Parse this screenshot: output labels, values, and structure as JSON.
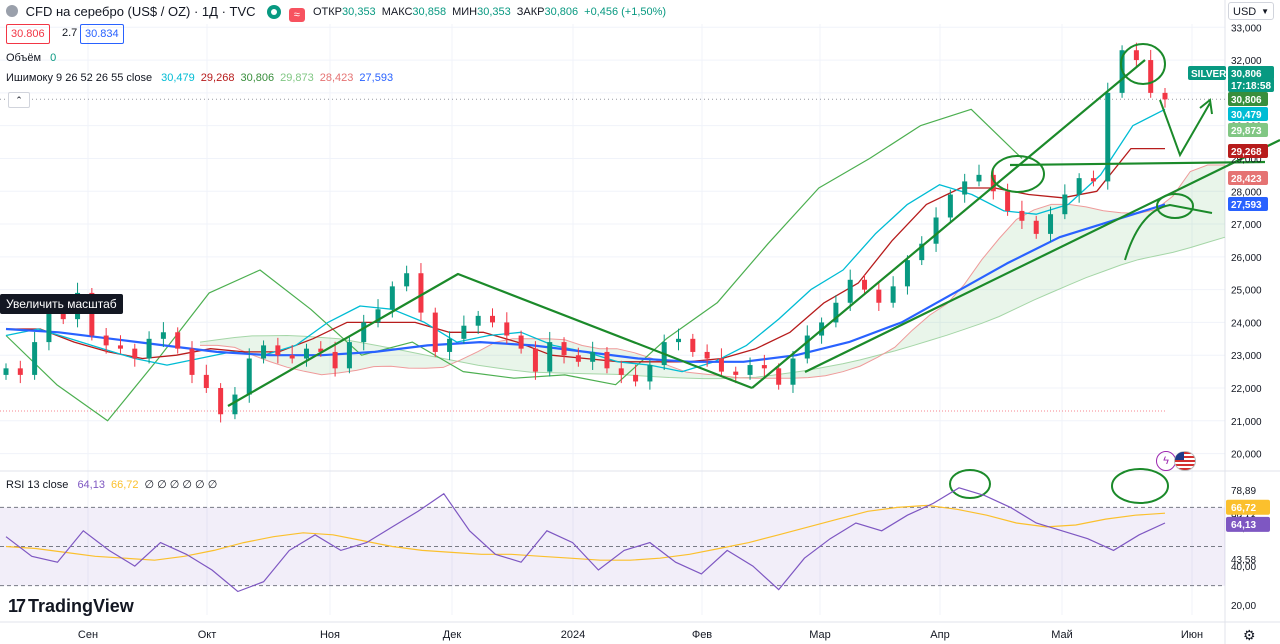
{
  "header": {
    "symbol": "CFD на серебро (US$ / OZ) · 1Д · TVC",
    "wave_icon": "≈",
    "ohlc": [
      {
        "k": "ОТКР",
        "v": "30,353"
      },
      {
        "k": "МАКС",
        "v": "30,858"
      },
      {
        "k": "МИН",
        "v": "30,353"
      },
      {
        "k": "ЗАКР",
        "v": "30,806"
      },
      {
        "k": "",
        "v": "+0,456 (+1,50%)"
      }
    ],
    "bid": "30.806",
    "spread": "2.7",
    "ask": "30.834",
    "volume_label": "Объём",
    "volume_value": "0",
    "ichimoku_label": "Ишимоку 9 26 52 26 55 close",
    "ichimoku_values": [
      {
        "v": "30,479",
        "c": "#00bcd4"
      },
      {
        "v": "29,268",
        "c": "#b71c1c"
      },
      {
        "v": "30,806",
        "c": "#388e3c"
      },
      {
        "v": "29,873",
        "c": "#81c784"
      },
      {
        "v": "28,423",
        "c": "#e57373"
      },
      {
        "v": "27,593",
        "c": "#2962ff"
      }
    ],
    "collapse": "⌃",
    "currency": "USD",
    "zoom_tooltip": "Увеличить масштаб",
    "rsi_label": "RSI 13 close",
    "rsi_values": [
      {
        "v": "64,13",
        "c": "#7e57c2"
      },
      {
        "v": "66,72",
        "c": "#fbc02d"
      },
      {
        "v": "∅ ∅ ∅ ∅ ∅ ∅",
        "c": "#131722"
      }
    ],
    "logo": "TradingView",
    "logo_mark": "17"
  },
  "chart_data": [
    {
      "type": "candlestick",
      "title": "CFD на серебро (US$ / OZ) · 1Д · TVC",
      "y_ticks": [
        "33,000",
        "32,000",
        "31,000",
        "30,000",
        "29,000",
        "28,000",
        "27,000",
        "26,000",
        "25,000",
        "24,000",
        "23,000",
        "22,000",
        "21,000",
        "20,000"
      ],
      "y_range": [
        19.5,
        33.1
      ],
      "x_labels": [
        "Сен",
        "Окт",
        "Ноя",
        "Дек",
        "2024",
        "Фев",
        "Мар",
        "Апр",
        "Май",
        "Июн"
      ],
      "price_tags": [
        {
          "text": "SILVER",
          "color": "#089981"
        },
        {
          "text": "30,806",
          "color": "#089981"
        },
        {
          "text": "17:18:58",
          "color": "#089981"
        },
        {
          "text": "30,806",
          "color": "#388e3c"
        },
        {
          "text": "30,479",
          "color": "#00bcd4"
        },
        {
          "text": "29,873",
          "color": "#81c784"
        },
        {
          "text": "29,268",
          "color": "#b71c1c"
        },
        {
          "text": "28,423",
          "color": "#e57373"
        },
        {
          "text": "27,593",
          "color": "#2962ff"
        }
      ],
      "close_series": [
        22.6,
        22.4,
        23.4,
        24.5,
        24.1,
        24.9,
        23.6,
        23.3,
        23.2,
        22.9,
        23.5,
        23.7,
        23.2,
        22.4,
        22.0,
        21.2,
        21.8,
        22.9,
        23.3,
        23.0,
        22.9,
        23.2,
        23.1,
        22.6,
        23.4,
        24.0,
        24.4,
        25.1,
        25.5,
        24.3,
        23.1,
        23.5,
        23.9,
        24.2,
        24.0,
        23.6,
        23.2,
        22.5,
        23.4,
        23.0,
        22.8,
        23.1,
        22.6,
        22.4,
        22.2,
        22.7,
        23.4,
        23.5,
        23.1,
        22.9,
        22.5,
        22.4,
        22.7,
        22.6,
        22.1,
        22.9,
        23.6,
        24.0,
        24.6,
        25.3,
        25.0,
        24.6,
        25.1,
        25.9,
        26.4,
        27.2,
        27.9,
        28.3,
        28.5,
        28.0,
        27.4,
        27.1,
        26.7,
        27.3,
        27.9,
        28.4,
        28.3,
        31.0,
        32.3,
        32.0,
        31.0,
        30.8
      ],
      "tenkan_series": [
        23.6,
        23.8,
        23.5,
        23.2,
        22.9,
        22.7,
        22.9,
        23.1,
        23.0,
        23.3,
        24.0,
        24.5,
        24.4,
        24.0,
        23.4,
        23.6,
        23.7,
        23.3,
        23.1,
        22.8,
        22.7,
        22.5,
        22.8,
        23.3,
        24.1,
        25.0,
        25.6,
        26.7,
        27.6,
        28.2,
        27.9,
        27.4,
        27.3,
        27.6,
        28.5,
        30.0,
        30.5
      ],
      "kijun_series": [
        23.8,
        23.8,
        23.4,
        23.1,
        22.9,
        23.0,
        23.2,
        23.1,
        23.1,
        23.5,
        24.0,
        24.0,
        24.0,
        23.7,
        23.7,
        23.4,
        23.0,
        22.9,
        22.8,
        22.8,
        22.8,
        22.9,
        23.2,
        23.7,
        24.6,
        25.2,
        26.5,
        27.6,
        28.1,
        28.1,
        27.9,
        27.8,
        28.0,
        29.3,
        29.3
      ],
      "chikou_series": [
        23.6,
        22.1,
        21.0,
        22.9,
        24.9,
        25.6,
        24.4,
        23.0,
        23.4,
        22.5,
        22.3,
        22.4,
        22.1,
        23.5,
        24.6,
        26.4,
        28.1,
        29.0,
        30.0,
        30.5,
        29.0
      ],
      "ma_series": [
        23.8,
        23.7,
        23.5,
        23.3,
        23.1,
        23.0,
        23.0,
        23.1,
        23.3,
        23.4,
        23.3,
        23.1,
        22.9,
        22.8,
        22.8,
        23.0,
        23.4,
        24.0,
        24.9,
        25.8,
        26.6,
        27.1,
        27.6
      ],
      "rsi": {
        "levels": [
          70,
          50,
          30
        ],
        "y_ticks": [
          "78,89",
          "66,72",
          "64,13",
          "60,00",
          "43,58",
          "40,00",
          "20,00"
        ],
        "y_range": [
          15,
          85
        ],
        "rsi_series": [
          55,
          45,
          42,
          58,
          48,
          40,
          52,
          46,
          38,
          27,
          32,
          48,
          56,
          48,
          52,
          60,
          68,
          77,
          58,
          46,
          42,
          58,
          52,
          38,
          48,
          52,
          42,
          36,
          48,
          40,
          28,
          44,
          54,
          62,
          58,
          66,
          72,
          80,
          76,
          70,
          62,
          58,
          54,
          48,
          56,
          62
        ],
        "ma_series": [
          50,
          49,
          47,
          45,
          44,
          43,
          45,
          48,
          52,
          55,
          57,
          56,
          53,
          50,
          48,
          47,
          46,
          46,
          45,
          44,
          43,
          43,
          44,
          46,
          49,
          52,
          56,
          60,
          64,
          68,
          70,
          71,
          69,
          66,
          62,
          60,
          61,
          64,
          66,
          67
        ]
      }
    }
  ]
}
